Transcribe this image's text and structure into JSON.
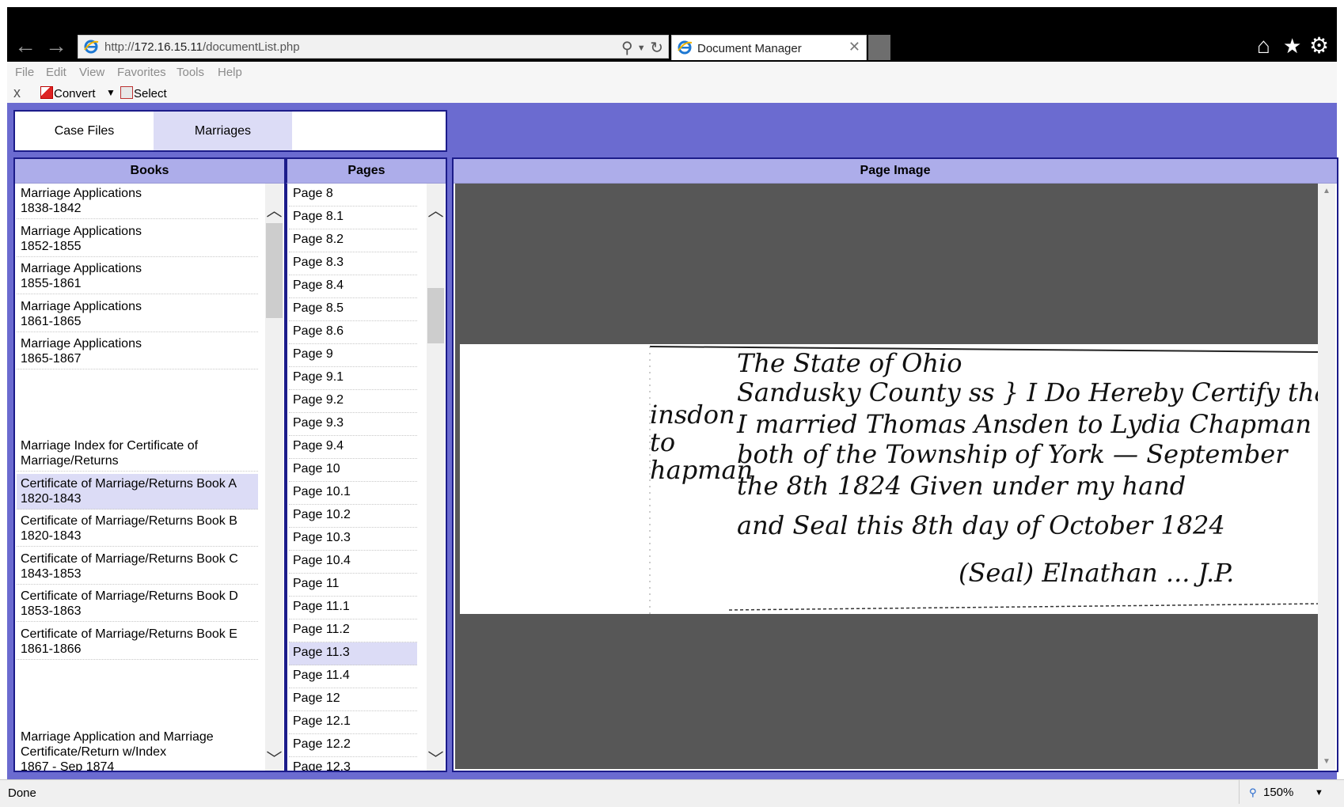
{
  "browser": {
    "url_prefix": "http://",
    "url_host": "172.16.15.11",
    "url_path": "/documentList.php",
    "tab_title": "Document Manager",
    "tab_close": "✕",
    "back": "←",
    "forward": "→",
    "search_icon": "⚲",
    "refresh_icon": "↻",
    "home_icon": "⌂",
    "favorites_icon": "★",
    "tools_icon": "⚙"
  },
  "menu": [
    "File",
    "Edit",
    "View",
    "Favorites",
    "Tools",
    "Help"
  ],
  "commandbar": {
    "close": "x",
    "convert": "Convert",
    "select": "Select",
    "caret": "▼"
  },
  "tabs": [
    {
      "label": "Case Files",
      "active": false
    },
    {
      "label": "Marriages",
      "active": true
    }
  ],
  "books": {
    "header": "Books",
    "items": [
      {
        "line1": "Marriage Applications",
        "line2": "1838-1842"
      },
      {
        "line1": "Marriage Applications",
        "line2": "1852-1855"
      },
      {
        "line1": "Marriage Applications",
        "line2": "1855-1861"
      },
      {
        "line1": "Marriage Applications",
        "line2": "1861-1865"
      },
      {
        "line1": "Marriage Applications",
        "line2": "1865-1867"
      },
      {
        "line1": "Marriage Index for Certificate of",
        "line2": "Marriage/Returns"
      },
      {
        "line1": "Certificate of Marriage/Returns Book A",
        "line2": "1820-1843",
        "selected": true
      },
      {
        "line1": "Certificate of Marriage/Returns Book B",
        "line2": "1820-1843"
      },
      {
        "line1": "Certificate of Marriage/Returns Book C",
        "line2": "1843-1853"
      },
      {
        "line1": "Certificate of Marriage/Returns Book D",
        "line2": "1853-1863"
      },
      {
        "line1": "Certificate of Marriage/Returns Book E",
        "line2": "1861-1866"
      },
      {
        "line1": "Marriage Application and Marriage",
        "line2": "Certificate/Return w/Index",
        "line3": "1867 - Sep 1874"
      }
    ]
  },
  "pages": {
    "header": "Pages",
    "items": [
      "Page 8",
      "Page 8.1",
      "Page 8.2",
      "Page 8.3",
      "Page 8.4",
      "Page 8.5",
      "Page 8.6",
      "Page 9",
      "Page 9.1",
      "Page 9.2",
      "Page 9.3",
      "Page 9.4",
      "Page 10",
      "Page 10.1",
      "Page 10.2",
      "Page 10.3",
      "Page 10.4",
      "Page 11",
      "Page 11.1",
      "Page 11.2",
      "Page 11.3",
      "Page 11.4",
      "Page 12",
      "Page 12.1",
      "Page 12.2",
      "Page 12.3"
    ],
    "selected": "Page 11.3"
  },
  "image_panel": {
    "header": "Page Image"
  },
  "status": {
    "text": "Done",
    "zoom": "150%",
    "zoom_caret": "▼"
  },
  "colors": {
    "app_bg": "#6b6bd0",
    "header_bg": "#adadea",
    "selected_bg": "#dcdcf6",
    "border": "#1c1c8a"
  }
}
